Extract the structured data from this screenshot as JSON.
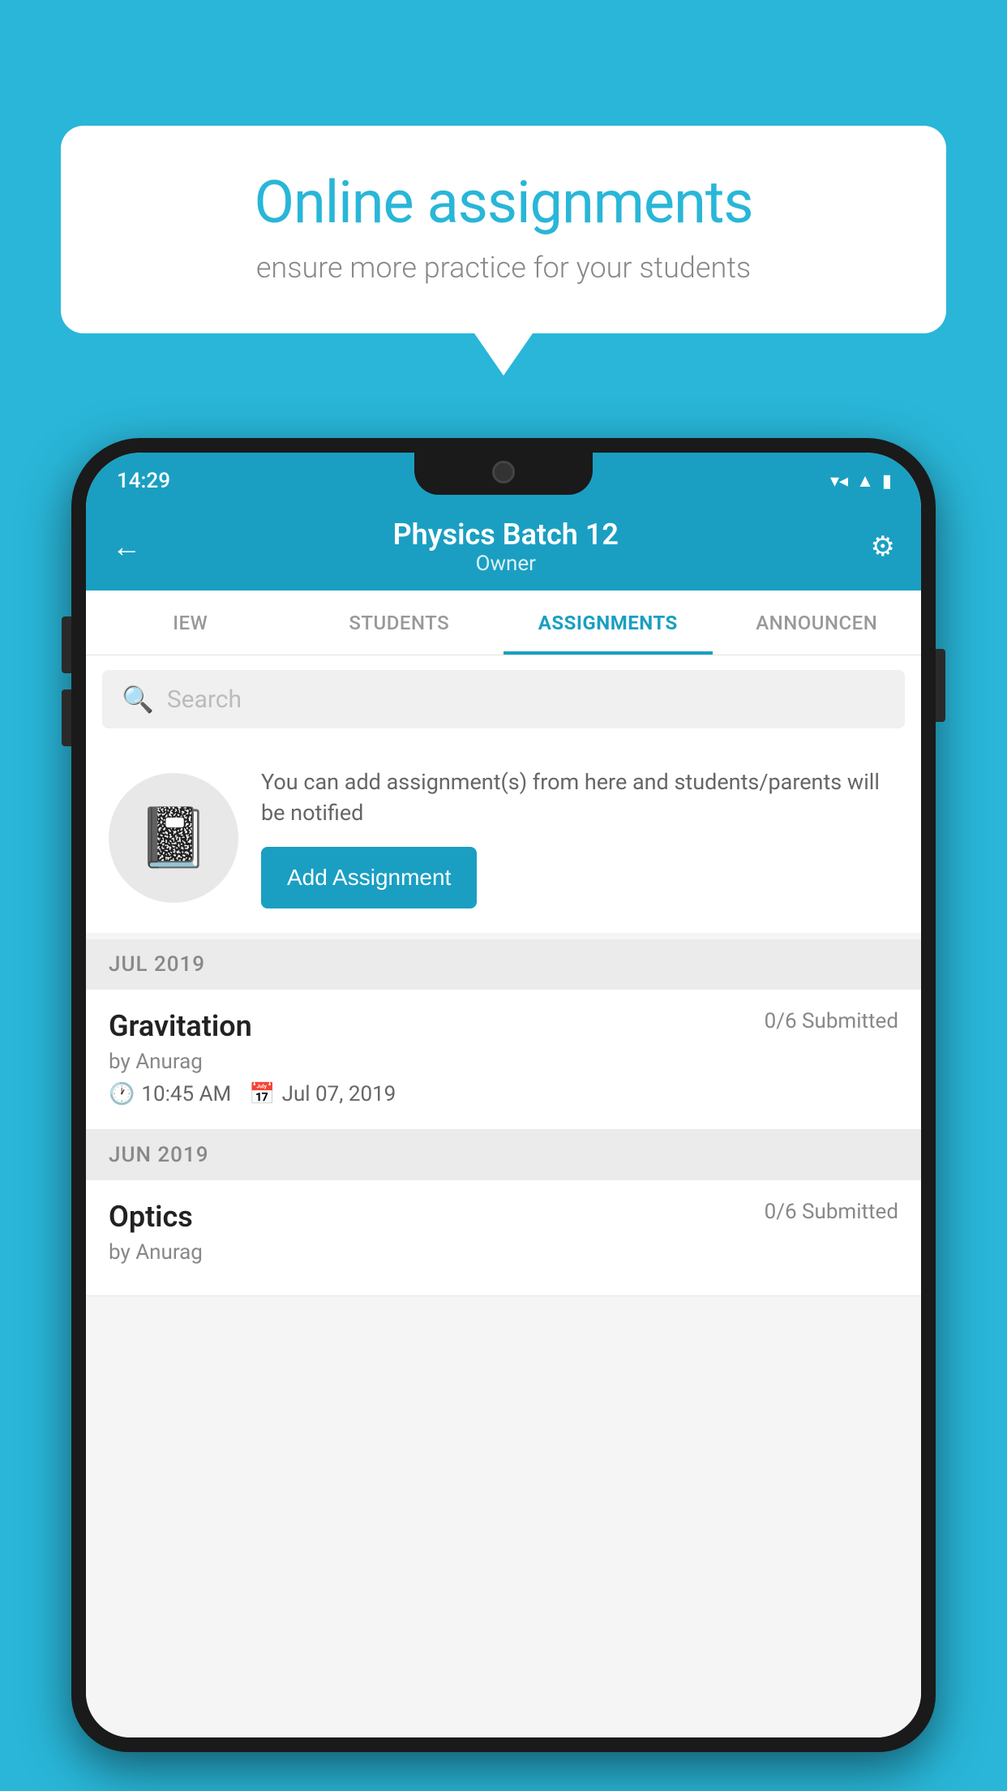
{
  "background_color": "#29b6d8",
  "speech_bubble": {
    "title": "Online assignments",
    "subtitle": "ensure more practice for your students"
  },
  "status_bar": {
    "time": "14:29",
    "icons": [
      "wifi",
      "signal",
      "battery"
    ]
  },
  "header": {
    "title": "Physics Batch 12",
    "subtitle": "Owner",
    "back_label": "←",
    "gear_label": "⚙"
  },
  "tabs": [
    {
      "label": "IEW",
      "active": false
    },
    {
      "label": "STUDENTS",
      "active": false
    },
    {
      "label": "ASSIGNMENTS",
      "active": true
    },
    {
      "label": "ANNOUNCEN",
      "active": false
    }
  ],
  "search": {
    "placeholder": "Search"
  },
  "promo": {
    "text": "You can add assignment(s) from here and students/parents will be notified",
    "button_label": "Add Assignment"
  },
  "sections": [
    {
      "header": "JUL 2019",
      "assignments": [
        {
          "name": "Gravitation",
          "submitted": "0/6 Submitted",
          "by": "by Anurag",
          "time": "10:45 AM",
          "date": "Jul 07, 2019"
        }
      ]
    },
    {
      "header": "JUN 2019",
      "assignments": [
        {
          "name": "Optics",
          "submitted": "0/6 Submitted",
          "by": "by Anurag",
          "time": "",
          "date": ""
        }
      ]
    }
  ]
}
